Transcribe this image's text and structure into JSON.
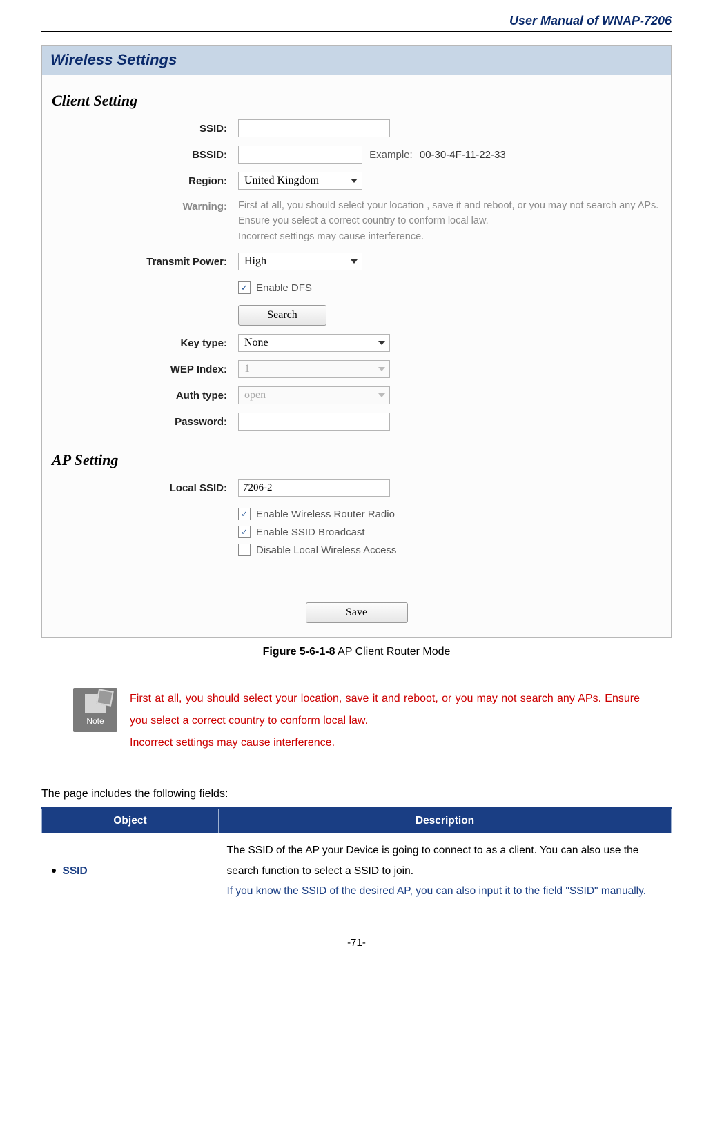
{
  "header": {
    "title": "User Manual of WNAP-7206"
  },
  "panel": {
    "title": "Wireless Settings",
    "client": {
      "heading": "Client Setting",
      "ssid_label": "SSID:",
      "ssid_value": "",
      "bssid_label": "BSSID:",
      "bssid_value": "",
      "example_label": "Example:",
      "example_value": "00-30-4F-11-22-33",
      "region_label": "Region:",
      "region_value": "United Kingdom",
      "warning_label": "Warning:",
      "warning_text": "First at all, you should select your location , save it and reboot, or you may not search any APs.\nEnsure you select a correct country to conform local law.\nIncorrect settings may cause interference.",
      "tx_label": "Transmit Power:",
      "tx_value": "High",
      "dfs_label": "Enable DFS",
      "dfs_checked": true,
      "search_btn": "Search",
      "keytype_label": "Key type:",
      "keytype_value": "None",
      "wepidx_label": "WEP Index:",
      "wepidx_value": "1",
      "authtype_label": "Auth type:",
      "authtype_value": "open",
      "password_label": "Password:",
      "password_value": ""
    },
    "ap": {
      "heading": "AP Setting",
      "local_ssid_label": "Local SSID:",
      "local_ssid_value": "7206-2",
      "opt1_label": "Enable Wireless Router Radio",
      "opt1_checked": true,
      "opt2_label": "Enable SSID Broadcast",
      "opt2_checked": true,
      "opt3_label": "Disable Local Wireless Access",
      "opt3_checked": false
    },
    "save_btn": "Save"
  },
  "figure": {
    "label": "Figure 5-6-1-8",
    "caption": "AP Client Router Mode"
  },
  "note": {
    "icon_label": "Note",
    "text": "First at all, you should select your location, save it and reboot, or you may not search any APs. Ensure you select a correct country to conform local law.\nIncorrect settings may cause interference."
  },
  "intro": "The page includes the following fields:",
  "table": {
    "head_object": "Object",
    "head_desc": "Description",
    "row1_object": "SSID",
    "row1_desc_black": "The SSID of the AP your Device is going to connect to as a client. You can also use the search function to select a SSID to join.",
    "row1_desc_blue": "If you know the SSID of the desired AP, you can also input it to the field \"SSID\" manually."
  },
  "page_number": "-71-"
}
